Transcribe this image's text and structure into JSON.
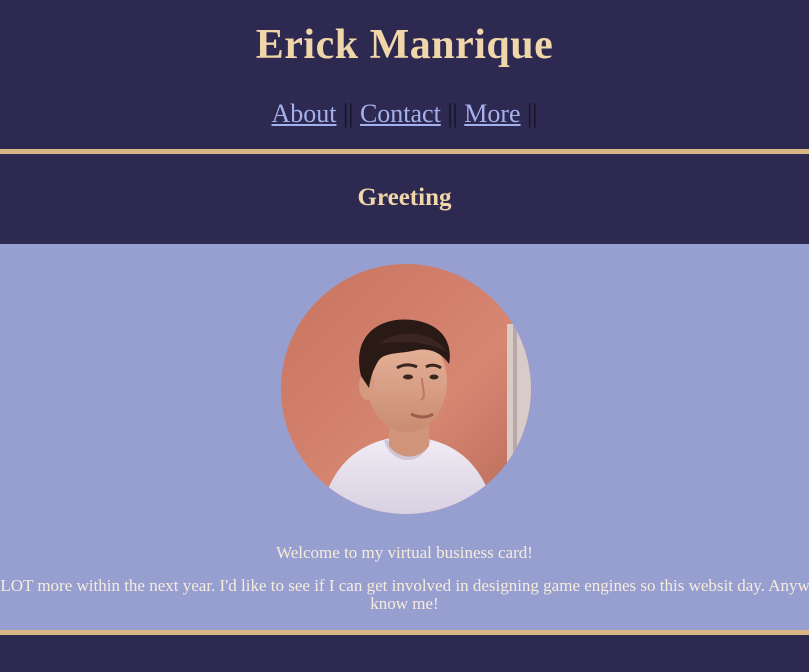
{
  "header": {
    "title": "Erick Manrique",
    "nav": {
      "items": [
        {
          "label": "About"
        },
        {
          "label": "Contact"
        },
        {
          "label": "More"
        }
      ],
      "separator": "||"
    }
  },
  "greeting": {
    "title": "Greeting"
  },
  "content": {
    "avatar_icon": "profile-photo",
    "welcome": "Welcome to my virtual business card!",
    "blurb": "it to be ALOT more within the next year. I'd like to see if I can get involved in designing game engines so this websit day. Anyway, get to know me!"
  },
  "colors": {
    "background": "#2d2951",
    "accent": "#f0d6a8",
    "rule": "#d7b584",
    "content_bg": "#979fd0",
    "link": "#a4b1ec"
  }
}
